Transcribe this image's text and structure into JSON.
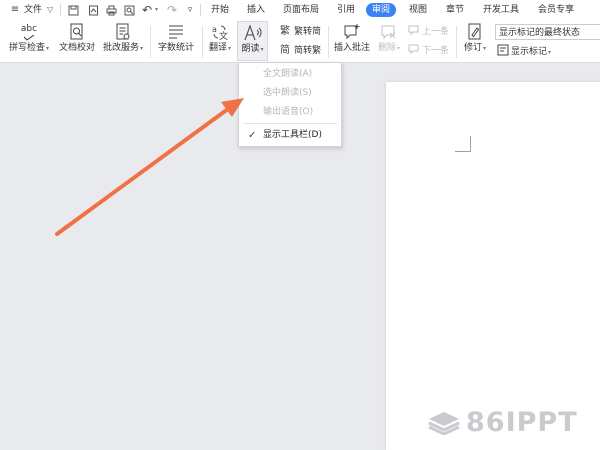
{
  "menubar": {
    "menu_glyph": "≡",
    "file_label": "文件",
    "file_caret": "▽",
    "quick_icons": [
      "save-icon",
      "export-pdf-icon",
      "print-icon",
      "print-preview-icon",
      "undo-icon",
      "redo-icon",
      "more-icon"
    ],
    "undo_glyph": "↶",
    "redo_glyph": "↷",
    "more_glyph": "▿",
    "tabs": [
      "开始",
      "插入",
      "页面布局",
      "引用",
      "审阅",
      "视图",
      "章节",
      "开发工具",
      "会员专享"
    ],
    "active_tab": "审阅",
    "accent_color": "#3b82f6"
  },
  "ribbon": {
    "spellcheck": {
      "icon_text": "abc",
      "label": "拼写检查"
    },
    "proofread": {
      "label": "文档校对"
    },
    "batch_service": {
      "label": "批改服务"
    },
    "word_count": {
      "label": "字数统计"
    },
    "translate": {
      "label": "翻译"
    },
    "read_aloud": {
      "label": "朗读"
    },
    "trad_convert": {
      "label": "繁转简"
    },
    "simp_convert": {
      "label": "简转繁"
    },
    "insert_comment": {
      "label": "插入批注"
    },
    "delete": {
      "label": "删除"
    },
    "prev": {
      "label": "上一条"
    },
    "next": {
      "label": "下一条"
    },
    "revise": {
      "label": "修订"
    },
    "show_markup": {
      "label": "显示标记"
    },
    "markup_status": "显示标记的最终状态",
    "caret": "▾"
  },
  "dropdown": {
    "items": [
      {
        "label": "全文朗读(A)",
        "enabled": false
      },
      {
        "label": "选中朗读(S)",
        "enabled": false
      },
      {
        "label": "输出语音(O)",
        "enabled": false
      },
      {
        "label": "显示工具栏(D)",
        "enabled": true,
        "checked": true
      }
    ],
    "check_glyph": "✓"
  },
  "annotation": {
    "arrow_color": "#f07146"
  },
  "watermark": {
    "text": "86IPPT"
  }
}
